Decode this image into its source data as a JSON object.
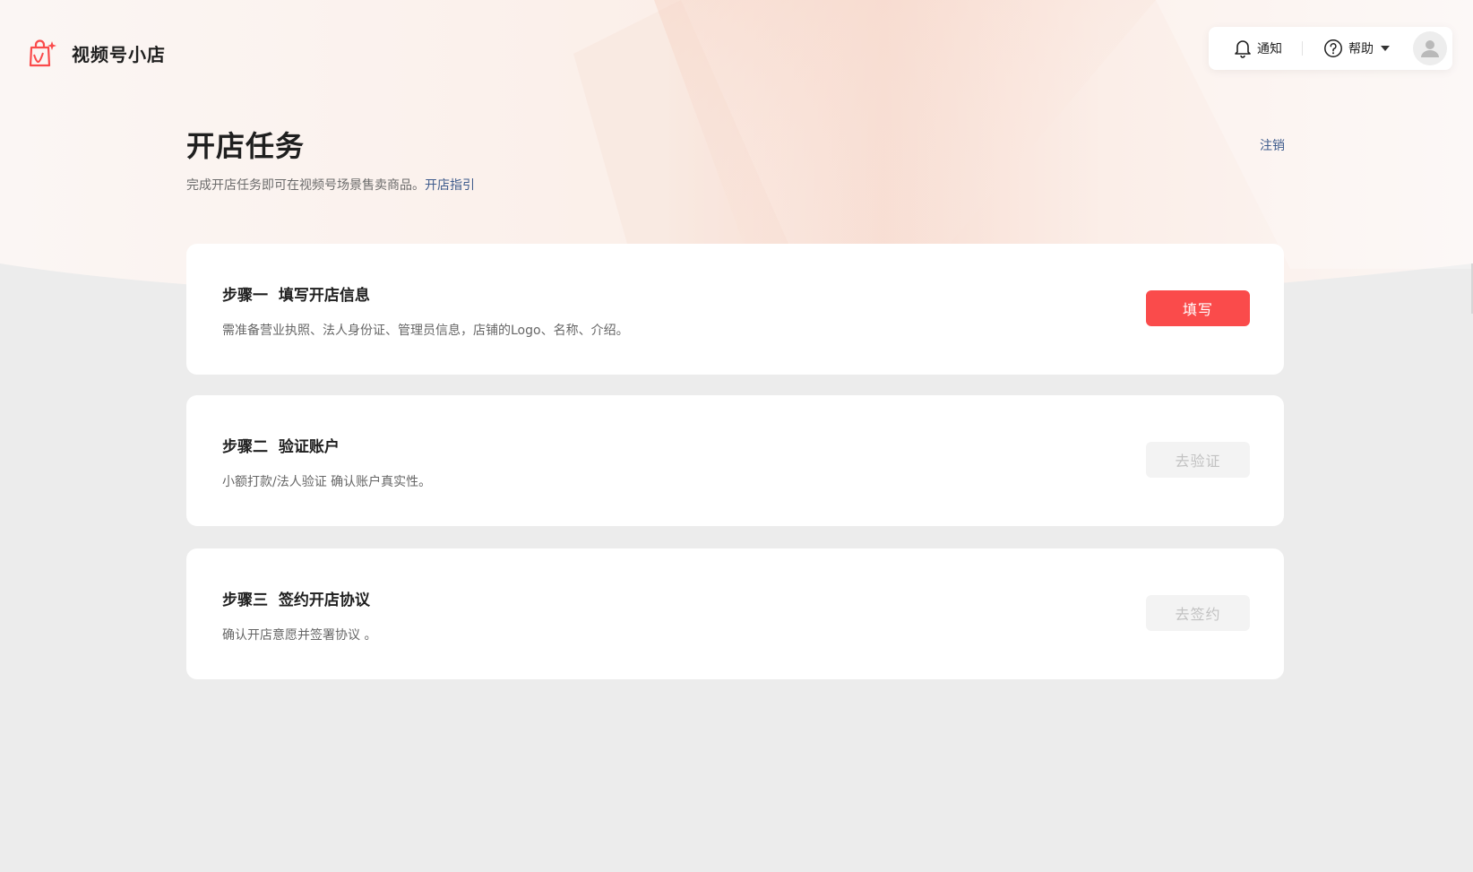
{
  "app": {
    "name": "视频号小店"
  },
  "topbar": {
    "notify_label": "通知",
    "help_label": "帮助"
  },
  "header": {
    "title": "开店任务",
    "subtitle": "完成开店任务即可在视频号场景售卖商品。",
    "guide_link": "开店指引",
    "logout": "注销"
  },
  "steps": [
    {
      "title": "步骤一  填写开店信息",
      "desc": "需准备营业执照、法人身份证、管理员信息，店铺的Logo、名称、介绍。",
      "button": "填写",
      "enabled": true
    },
    {
      "title": "步骤二  验证账户",
      "desc": "小额打款/法人验证 确认账户真实性。",
      "button": "去验证",
      "enabled": false
    },
    {
      "title": "步骤三  签约开店协议",
      "desc": "确认开店意愿并签署协议 。",
      "button": "去签约",
      "enabled": false
    }
  ],
  "colors": {
    "primary": "#fa4b4b",
    "link": "#3e5b8c",
    "disabled_bg": "#f3f3f3",
    "disabled_text": "#c2c2c2",
    "page_bg": "#ececec"
  },
  "icons": {
    "logo": "shopping-bag-icon",
    "notify": "bell-icon",
    "help": "question-circle-icon",
    "avatar": "user-icon",
    "caret": "caret-down-icon"
  }
}
